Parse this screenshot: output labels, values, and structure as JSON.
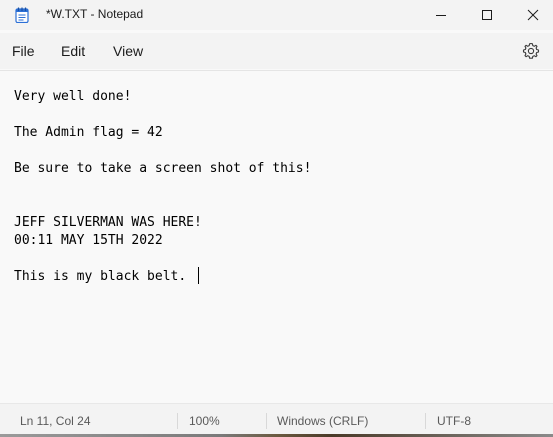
{
  "window": {
    "title": "*W.TXT - Notepad",
    "app_icon": "notepad-icon"
  },
  "titlebar_buttons": {
    "minimize_icon": "minimize-icon",
    "maximize_icon": "maximize-icon",
    "close_icon": "close-icon"
  },
  "menu": {
    "file": "File",
    "edit": "Edit",
    "view": "View",
    "settings_icon": "gear-icon"
  },
  "editor": {
    "lines": [
      "Very well done!",
      "The Admin flag = 42",
      "Be sure to take a screen shot of this!",
      "JEFF SILVERMAN WAS HERE!",
      "00:11 MAY 15TH 2022",
      "This is my black belt. "
    ]
  },
  "status": {
    "position": "Ln 11, Col 24",
    "zoom": "100%",
    "line_ending": "Windows (CRLF)",
    "encoding": "UTF-8"
  },
  "colors": {
    "chrome_bg": "#f3f3f3",
    "editor_bg": "#f9f9f9",
    "text": "#000000",
    "status_text": "#5a5a5a",
    "icon_blue": "#2b6fd6"
  }
}
